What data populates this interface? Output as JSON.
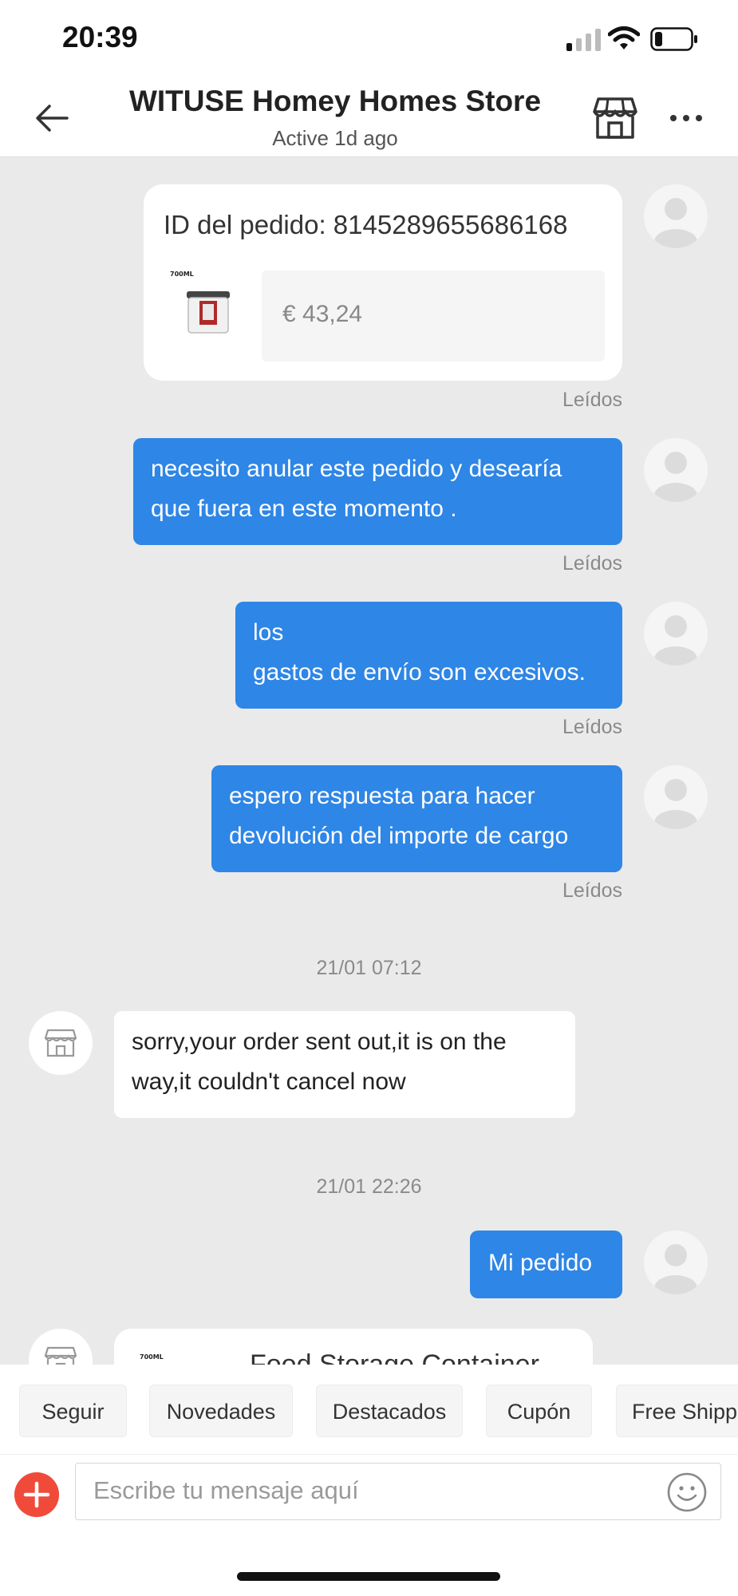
{
  "status_bar": {
    "time": "20:39"
  },
  "header": {
    "title": "WITUSE Homey Homes Store",
    "subtitle": "Active 1d ago"
  },
  "order_card": {
    "order_id": "ID del pedido: 8145289655686168",
    "thumb_label": "700ML",
    "price": "€ 43,24",
    "read_status": "Leídos"
  },
  "messages": [
    {
      "direction": "out",
      "lines": [
        "necesito anular este pedido y desearía",
        "que fuera en este momento ."
      ],
      "read_status": "Leídos"
    },
    {
      "direction": "out",
      "lines": [
        "los",
        "gastos de envío son excesivos."
      ],
      "read_status": "Leídos"
    },
    {
      "direction": "out",
      "lines": [
        "espero respuesta para hacer",
        "devolución del importe de cargo"
      ],
      "read_status": "Leídos"
    },
    {
      "direction": "time",
      "text": "21/01 07:12"
    },
    {
      "direction": "in",
      "lines": [
        "sorry,your order sent out,it is on the",
        "way,it couldn't cancel now"
      ]
    },
    {
      "direction": "time",
      "text": "21/01 22:26"
    },
    {
      "direction": "out",
      "lines": [
        "Mi pedido"
      ]
    }
  ],
  "partial_card": {
    "thumb_label": "700ML",
    "title": "Food Storage Container"
  },
  "quick_replies": [
    "Seguir",
    "Novedades",
    "Destacados",
    "Cupón",
    "Free Shipp"
  ],
  "composer": {
    "placeholder": "Escribe tu mensaje aquí"
  },
  "colors": {
    "accent_blue": "#2e86e6",
    "plus_red": "#f04b3a",
    "chat_bg": "#eaeaea"
  },
  "icons": [
    "back-arrow-icon",
    "store-icon",
    "more-icon",
    "plus-icon",
    "emoji-icon",
    "avatar-icon",
    "store-avatar-icon"
  ]
}
